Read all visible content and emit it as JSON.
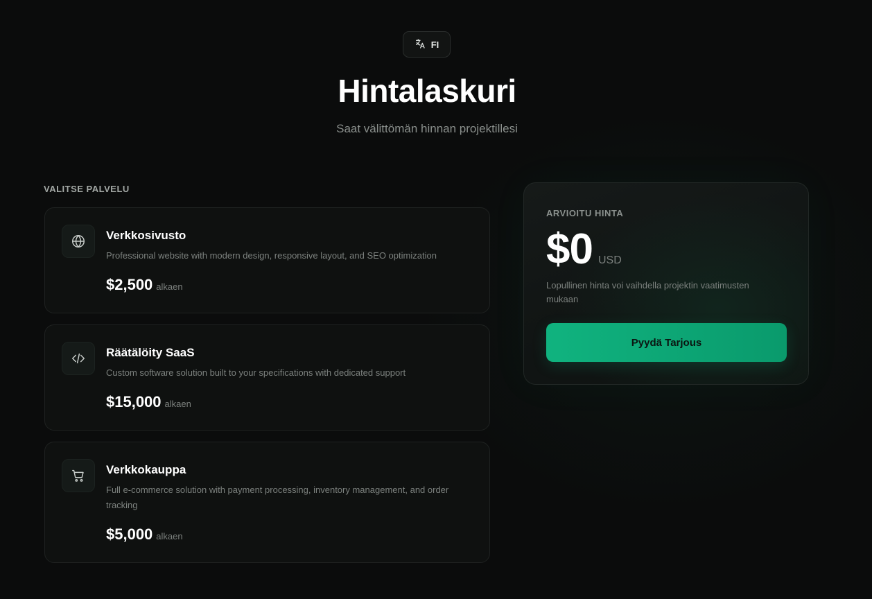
{
  "language": {
    "code": "FI",
    "icon": "translate-icon"
  },
  "header": {
    "title": "Hintalaskuri",
    "subtitle": "Saat välittömän hinnan projektillesi"
  },
  "services": {
    "section_label": "VALITSE PALVELU",
    "items": [
      {
        "icon": "globe-icon",
        "title": "Verkkosivusto",
        "description": "Professional website with modern design, responsive layout, and SEO optimization",
        "price": "$2,500",
        "price_suffix": "alkaen"
      },
      {
        "icon": "code-icon",
        "title": "Räätälöity SaaS",
        "description": "Custom software solution built to your specifications with dedicated support",
        "price": "$15,000",
        "price_suffix": "alkaen"
      },
      {
        "icon": "cart-icon",
        "title": "Verkkokauppa",
        "description": "Full e-commerce solution with payment processing, inventory management, and order tracking",
        "price": "$5,000",
        "price_suffix": "alkaen"
      }
    ]
  },
  "estimate": {
    "label": "ARVIOITU HINTA",
    "price": "$0",
    "currency": "USD",
    "note": "Lopullinen hinta voi vaihdella projektin vaatimusten mukaan",
    "button_label": "Pyydä Tarjous"
  },
  "colors": {
    "background": "#0b0c0c",
    "accent": "#10b37f",
    "card_border": "#1f2221",
    "muted_text": "#7c817e"
  }
}
